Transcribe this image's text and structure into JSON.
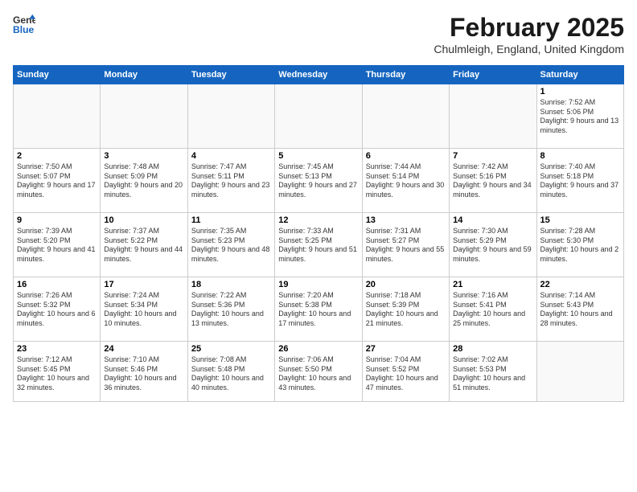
{
  "header": {
    "logo_line1": "General",
    "logo_line2": "Blue",
    "title": "February 2025",
    "location": "Chulmleigh, England, United Kingdom"
  },
  "days_of_week": [
    "Sunday",
    "Monday",
    "Tuesday",
    "Wednesday",
    "Thursday",
    "Friday",
    "Saturday"
  ],
  "weeks": [
    [
      {
        "day": "",
        "detail": ""
      },
      {
        "day": "",
        "detail": ""
      },
      {
        "day": "",
        "detail": ""
      },
      {
        "day": "",
        "detail": ""
      },
      {
        "day": "",
        "detail": ""
      },
      {
        "day": "",
        "detail": ""
      },
      {
        "day": "1",
        "detail": "Sunrise: 7:52 AM\nSunset: 5:06 PM\nDaylight: 9 hours and 13 minutes."
      }
    ],
    [
      {
        "day": "2",
        "detail": "Sunrise: 7:50 AM\nSunset: 5:07 PM\nDaylight: 9 hours and 17 minutes."
      },
      {
        "day": "3",
        "detail": "Sunrise: 7:48 AM\nSunset: 5:09 PM\nDaylight: 9 hours and 20 minutes."
      },
      {
        "day": "4",
        "detail": "Sunrise: 7:47 AM\nSunset: 5:11 PM\nDaylight: 9 hours and 23 minutes."
      },
      {
        "day": "5",
        "detail": "Sunrise: 7:45 AM\nSunset: 5:13 PM\nDaylight: 9 hours and 27 minutes."
      },
      {
        "day": "6",
        "detail": "Sunrise: 7:44 AM\nSunset: 5:14 PM\nDaylight: 9 hours and 30 minutes."
      },
      {
        "day": "7",
        "detail": "Sunrise: 7:42 AM\nSunset: 5:16 PM\nDaylight: 9 hours and 34 minutes."
      },
      {
        "day": "8",
        "detail": "Sunrise: 7:40 AM\nSunset: 5:18 PM\nDaylight: 9 hours and 37 minutes."
      }
    ],
    [
      {
        "day": "9",
        "detail": "Sunrise: 7:39 AM\nSunset: 5:20 PM\nDaylight: 9 hours and 41 minutes."
      },
      {
        "day": "10",
        "detail": "Sunrise: 7:37 AM\nSunset: 5:22 PM\nDaylight: 9 hours and 44 minutes."
      },
      {
        "day": "11",
        "detail": "Sunrise: 7:35 AM\nSunset: 5:23 PM\nDaylight: 9 hours and 48 minutes."
      },
      {
        "day": "12",
        "detail": "Sunrise: 7:33 AM\nSunset: 5:25 PM\nDaylight: 9 hours and 51 minutes."
      },
      {
        "day": "13",
        "detail": "Sunrise: 7:31 AM\nSunset: 5:27 PM\nDaylight: 9 hours and 55 minutes."
      },
      {
        "day": "14",
        "detail": "Sunrise: 7:30 AM\nSunset: 5:29 PM\nDaylight: 9 hours and 59 minutes."
      },
      {
        "day": "15",
        "detail": "Sunrise: 7:28 AM\nSunset: 5:30 PM\nDaylight: 10 hours and 2 minutes."
      }
    ],
    [
      {
        "day": "16",
        "detail": "Sunrise: 7:26 AM\nSunset: 5:32 PM\nDaylight: 10 hours and 6 minutes."
      },
      {
        "day": "17",
        "detail": "Sunrise: 7:24 AM\nSunset: 5:34 PM\nDaylight: 10 hours and 10 minutes."
      },
      {
        "day": "18",
        "detail": "Sunrise: 7:22 AM\nSunset: 5:36 PM\nDaylight: 10 hours and 13 minutes."
      },
      {
        "day": "19",
        "detail": "Sunrise: 7:20 AM\nSunset: 5:38 PM\nDaylight: 10 hours and 17 minutes."
      },
      {
        "day": "20",
        "detail": "Sunrise: 7:18 AM\nSunset: 5:39 PM\nDaylight: 10 hours and 21 minutes."
      },
      {
        "day": "21",
        "detail": "Sunrise: 7:16 AM\nSunset: 5:41 PM\nDaylight: 10 hours and 25 minutes."
      },
      {
        "day": "22",
        "detail": "Sunrise: 7:14 AM\nSunset: 5:43 PM\nDaylight: 10 hours and 28 minutes."
      }
    ],
    [
      {
        "day": "23",
        "detail": "Sunrise: 7:12 AM\nSunset: 5:45 PM\nDaylight: 10 hours and 32 minutes."
      },
      {
        "day": "24",
        "detail": "Sunrise: 7:10 AM\nSunset: 5:46 PM\nDaylight: 10 hours and 36 minutes."
      },
      {
        "day": "25",
        "detail": "Sunrise: 7:08 AM\nSunset: 5:48 PM\nDaylight: 10 hours and 40 minutes."
      },
      {
        "day": "26",
        "detail": "Sunrise: 7:06 AM\nSunset: 5:50 PM\nDaylight: 10 hours and 43 minutes."
      },
      {
        "day": "27",
        "detail": "Sunrise: 7:04 AM\nSunset: 5:52 PM\nDaylight: 10 hours and 47 minutes."
      },
      {
        "day": "28",
        "detail": "Sunrise: 7:02 AM\nSunset: 5:53 PM\nDaylight: 10 hours and 51 minutes."
      },
      {
        "day": "",
        "detail": ""
      }
    ]
  ]
}
